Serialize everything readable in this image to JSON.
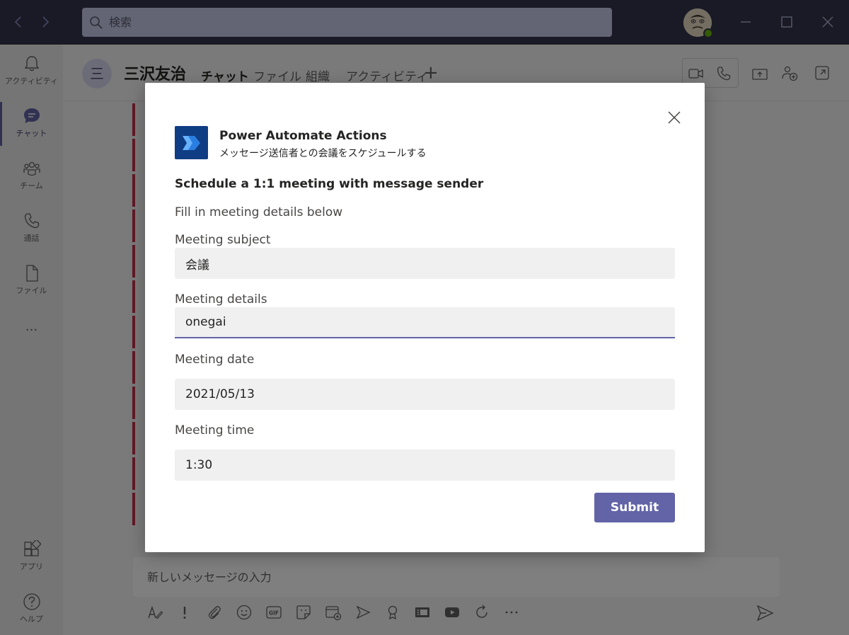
{
  "search": {
    "placeholder": "検索"
  },
  "rail": {
    "items": [
      {
        "label": "アクティビティ",
        "icon": "bell-icon"
      },
      {
        "label": "チャット",
        "icon": "chat-icon"
      },
      {
        "label": "チーム",
        "icon": "teams-icon"
      },
      {
        "label": "通話",
        "icon": "phone-icon"
      },
      {
        "label": "ファイル",
        "icon": "file-icon"
      },
      {
        "label": "アプリ",
        "icon": "apps-icon"
      },
      {
        "label": "ヘルプ",
        "icon": "help-icon"
      }
    ],
    "more": "···"
  },
  "chat": {
    "avatar_initial": "三",
    "name": "三沢友治",
    "tabs": [
      "チャット",
      "ファイル",
      "組織",
      "アクティビティ"
    ],
    "tab_add": "+"
  },
  "compose": {
    "placeholder": "新しいメッセージの入力"
  },
  "dialog": {
    "app_name": "Power Automate Actions",
    "app_subtitle": "メッセージ送信者との会議をスケジュールする",
    "title": "Schedule a 1:1 meeting with message sender",
    "description": "Fill in meeting details below",
    "fields": [
      {
        "label": "Meeting subject",
        "value": "会議"
      },
      {
        "label": "Meeting details",
        "value": "onegai"
      },
      {
        "label": "Meeting date",
        "value": "2021/05/13"
      },
      {
        "label": "Meeting time",
        "value": "1:30"
      }
    ],
    "submit_label": "Submit"
  },
  "colors": {
    "brand": "#6264a7",
    "titlebar": "#33344a",
    "power_automate": "#0f3d83"
  }
}
